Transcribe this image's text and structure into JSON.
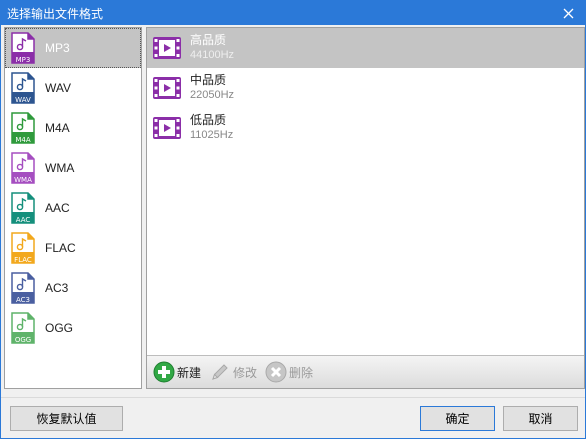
{
  "window": {
    "title": "选择输出文件格式"
  },
  "formats": [
    {
      "label": "MP3",
      "badge": "MP3",
      "color": "#8b2ea8",
      "selected": true
    },
    {
      "label": "WAV",
      "badge": "WAV",
      "color": "#2d5590",
      "selected": false
    },
    {
      "label": "M4A",
      "badge": "M4A",
      "color": "#2f9a3c",
      "selected": false
    },
    {
      "label": "WMA",
      "badge": "WMA",
      "color": "#a54ec0",
      "selected": false
    },
    {
      "label": "AAC",
      "badge": "AAC",
      "color": "#158f7c",
      "selected": false
    },
    {
      "label": "FLAC",
      "badge": "FLAC",
      "color": "#f2a81d",
      "selected": false
    },
    {
      "label": "AC3",
      "badge": "AC3",
      "color": "#4a5fa0",
      "selected": false
    },
    {
      "label": "OGG",
      "badge": "OGG",
      "color": "#5fb36a",
      "selected": false
    }
  ],
  "qualities": [
    {
      "name": "高品质",
      "rate": "44100Hz",
      "selected": true
    },
    {
      "name": "中品质",
      "rate": "22050Hz",
      "selected": false
    },
    {
      "name": "低品质",
      "rate": "11025Hz",
      "selected": false
    }
  ],
  "toolbar": {
    "new_label": "新建",
    "edit_label": "修改",
    "delete_label": "删除"
  },
  "buttons": {
    "restore_default": "恢复默认值",
    "ok": "确定",
    "cancel": "取消"
  },
  "icons": {
    "close": "close-icon",
    "format": "audio-file-icon",
    "quality": "video-play-icon",
    "new": "plus-circle-icon",
    "edit": "pencil-icon",
    "delete": "x-circle-icon"
  },
  "colors": {
    "title_bar": "#2b79d8",
    "quality_icon": "#8b2ea8",
    "selection": "#c4c4c4"
  }
}
